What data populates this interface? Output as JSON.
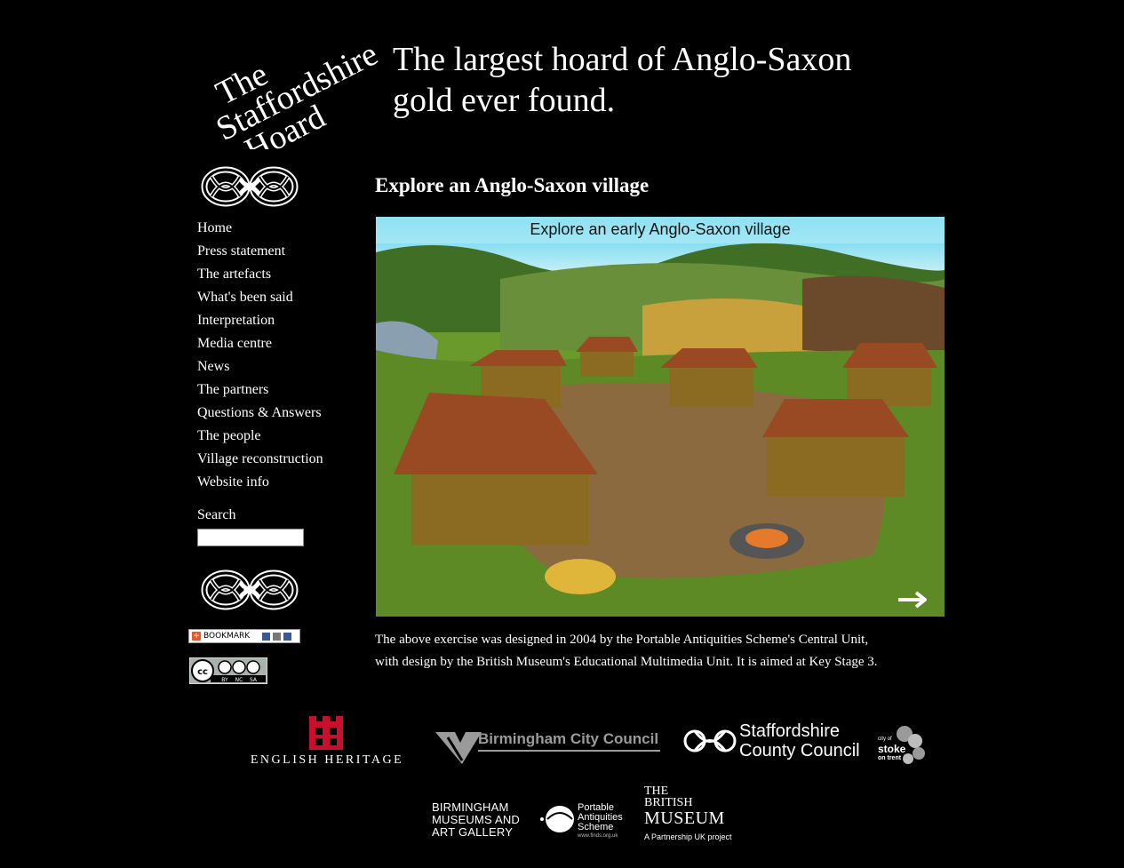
{
  "site": {
    "logo_lines": [
      "The",
      "Staffordshire",
      "Hoard"
    ],
    "tagline_line1": "The largest hoard of Anglo-Saxon",
    "tagline_line2": "gold ever found."
  },
  "nav": {
    "items": [
      {
        "label": "Home"
      },
      {
        "label": "Press statement"
      },
      {
        "label": "The artefacts"
      },
      {
        "label": "What's been said"
      },
      {
        "label": "Interpretation"
      },
      {
        "label": "Media centre"
      },
      {
        "label": "News"
      },
      {
        "label": "The partners"
      },
      {
        "label": "Questions & Answers"
      },
      {
        "label": "The people"
      },
      {
        "label": "Village reconstruction"
      },
      {
        "label": "Website info"
      }
    ]
  },
  "search": {
    "label": "Search",
    "value": ""
  },
  "bookmark": {
    "label": "BOOKMARK"
  },
  "license": {
    "badges": [
      "BY",
      "NC",
      "SA"
    ]
  },
  "main": {
    "heading": "Explore an Anglo-Saxon village",
    "interactive_title": "Explore an early Anglo-Saxon village",
    "next_icon": "arrow-right-icon",
    "description_line1": "The above exercise was designed in 2004 by the Portable Antiquities Scheme's Central Unit,",
    "description_line2": "with design by the British Museum's Educational Multimedia Unit. It is aimed at Key Stage 3."
  },
  "partners": {
    "english_heritage": "ENGLISH HERITAGE",
    "birmingham_cc": "Birmingham City Council",
    "staffordshire_cc_line1": "Staffordshire",
    "staffordshire_cc_line2": "County Council",
    "stoke_line1": "city of",
    "stoke_line2": "stoke",
    "stoke_line3": "on trent",
    "bmag_line1": "BIRMINGHAM",
    "bmag_line2": "MUSEUMS AND",
    "bmag_line3": "ART GALLERY",
    "pas_line1": "Portable",
    "pas_line2": "Antiquities",
    "pas_line3": "Scheme",
    "pas_url": "www.finds.org.uk",
    "bm_line1": "THE",
    "bm_line2": "BRITISH",
    "bm_line3": "MUSEUM",
    "bm_line4": "A Partnership UK project"
  },
  "colors": {
    "background": "#000000",
    "text": "#ffffff",
    "eh_red": "#c8102e"
  }
}
